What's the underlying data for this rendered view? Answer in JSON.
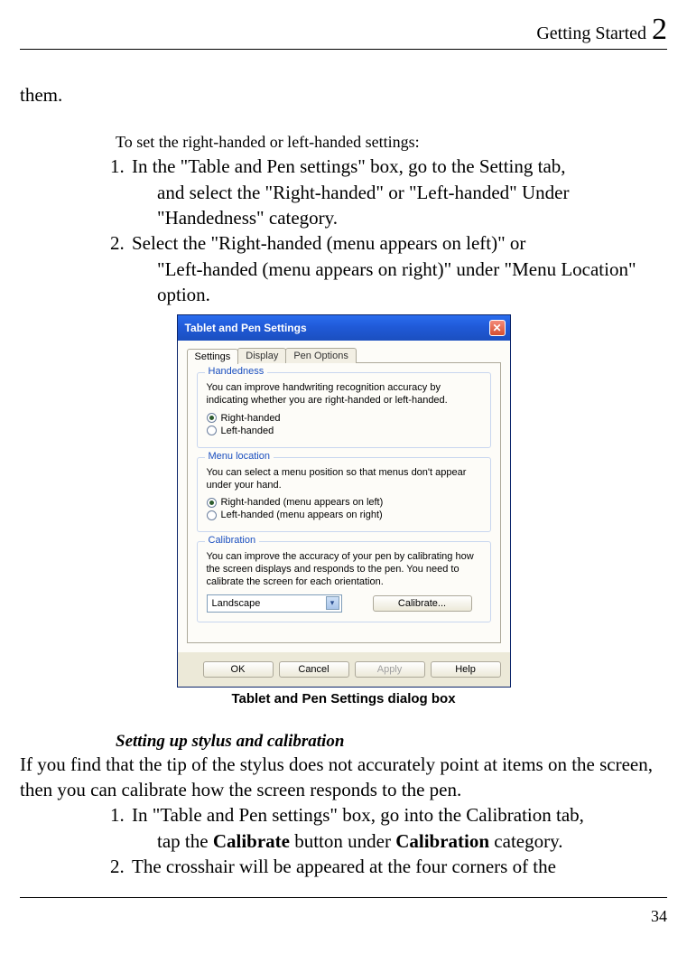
{
  "header": {
    "title": "Getting Started",
    "chapter_number": "2"
  },
  "page_number": "34",
  "fragment_top": "them.",
  "intro_line": "To set the right-handed or left-handed settings:",
  "steps_a": [
    {
      "n": "1.",
      "first": "In the \"Table and Pen settings\" box, go    to the Setting tab,",
      "cont": "and select the \"Right-handed\" or \"Left-handed\" Under \"Handedness\" category."
    },
    {
      "n": "2.",
      "first": "Select the \"Right-handed (menu appears on left)\" or",
      "cont": "\"Left-handed (menu appears on right)\" under \"Menu Location\" option."
    }
  ],
  "dialog": {
    "title": "Tablet and Pen Settings",
    "close_glyph": "✕",
    "tabs": [
      {
        "label": "Settings",
        "active": true
      },
      {
        "label": "Display",
        "active": false
      },
      {
        "label": "Pen Options",
        "active": false
      }
    ],
    "handedness": {
      "legend": "Handedness",
      "desc": "You can improve handwriting recognition accuracy by indicating whether you are right-handed or left-handed.",
      "options": [
        {
          "label": "Right-handed",
          "selected": true
        },
        {
          "label": "Left-handed",
          "selected": false
        }
      ]
    },
    "menu_location": {
      "legend": "Menu location",
      "desc": "You can select a menu position so that menus don't appear under your hand.",
      "options": [
        {
          "label": "Right-handed (menu appears on left)",
          "selected": true
        },
        {
          "label": "Left-handed (menu appears on right)",
          "selected": false
        }
      ]
    },
    "calibration": {
      "legend": "Calibration",
      "desc": "You can improve the accuracy of your pen by calibrating how the screen displays and responds to the pen. You need to calibrate the screen for each orientation.",
      "combo_value": "Landscape",
      "button": "Calibrate..."
    },
    "buttons": {
      "ok": "OK",
      "cancel": "Cancel",
      "apply": "Apply",
      "help": "Help"
    }
  },
  "caption": "Tablet and Pen Settings dialog box",
  "subheading": "Setting up stylus and calibration",
  "para_b": "If you find that the tip of the stylus does not accurately point at items on the screen, then you can calibrate how the screen responds to the pen.",
  "steps_b": [
    {
      "n": "1.",
      "first_pre": "In \"Table and Pen settings\" box, go into the Calibration tab,",
      "cont_pre": "tap the ",
      "bold1": "Calibrate",
      "mid": " button under ",
      "bold2": "Calibration",
      "post": " category."
    },
    {
      "n": "2.",
      "first_pre": "The crosshair will be appeared at the four corners of the"
    }
  ]
}
